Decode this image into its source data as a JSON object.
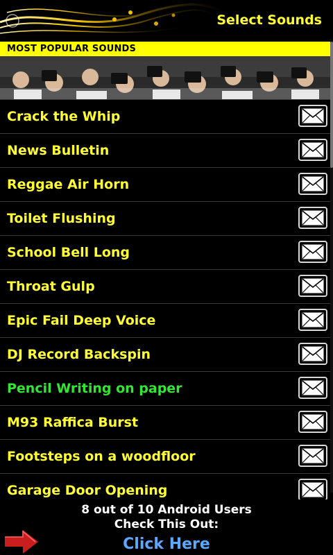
{
  "header": {
    "title": "Select Sounds"
  },
  "banner": {
    "label": "MOST POPULAR SOUNDS"
  },
  "sounds": [
    {
      "label": "Crack the Whip",
      "highlight": false
    },
    {
      "label": "News Bulletin",
      "highlight": false
    },
    {
      "label": "Reggae Air Horn",
      "highlight": false
    },
    {
      "label": "Toilet Flushing",
      "highlight": false
    },
    {
      "label": "School Bell Long",
      "highlight": false
    },
    {
      "label": "Throat Gulp",
      "highlight": false
    },
    {
      "label": "Epic Fail Deep Voice",
      "highlight": false
    },
    {
      "label": "DJ Record Backspin",
      "highlight": false
    },
    {
      "label": "Pencil Writing on paper",
      "highlight": true
    },
    {
      "label": "M93 Raffica Burst",
      "highlight": false
    },
    {
      "label": "Footsteps on a woodfloor",
      "highlight": false
    },
    {
      "label": "Garage Door Opening",
      "highlight": false
    }
  ],
  "footer": {
    "line1": "8 out of 10 Android Users",
    "line2": "Check This Out:",
    "cta": "Click Here"
  },
  "colors": {
    "title": "#ffff33",
    "label": "#ffff33",
    "label_highlight": "#33e633",
    "banner_strip": "#ffff00",
    "cta": "#5aa8ff",
    "arrow": "#c81e1e"
  },
  "icons": {
    "share": "envelope-icon",
    "promo": "arrow-right-icon"
  }
}
